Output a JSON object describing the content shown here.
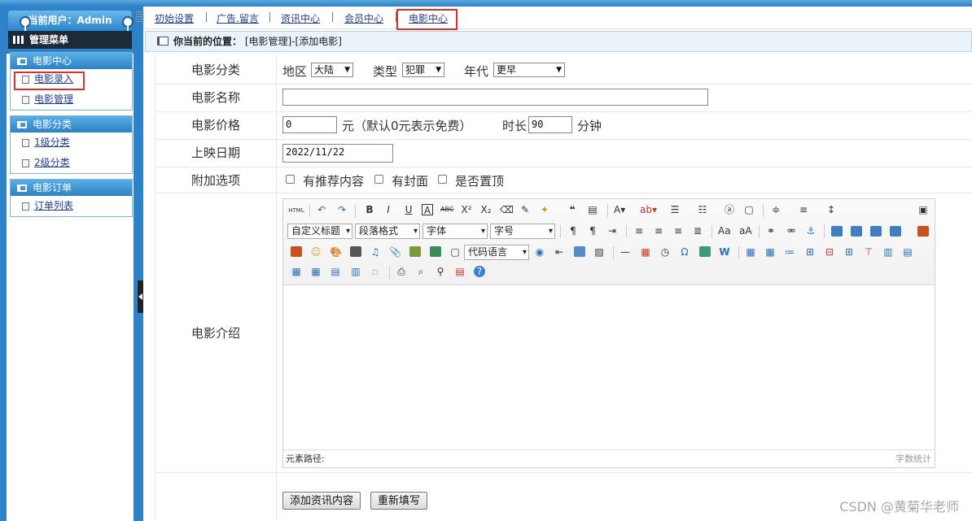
{
  "header": {
    "user_label": "当前用户：Admin"
  },
  "sidebar": {
    "menu_title": "管理菜单",
    "groups": [
      {
        "title": "电影中心",
        "items": [
          "电影录入",
          "电影管理"
        ]
      },
      {
        "title": "电影分类",
        "items": [
          "1级分类",
          "2级分类"
        ]
      },
      {
        "title": "电影订单",
        "items": [
          "订单列表"
        ]
      }
    ]
  },
  "nav": {
    "items": [
      "初始设置",
      "广告.留言",
      "资讯中心",
      "会员中心",
      "电影中心"
    ]
  },
  "breadcrumb": {
    "prefix": "你当前的位置：",
    "path": "[电影管理]-[添加电影]"
  },
  "form": {
    "category": {
      "label": "电影分类",
      "region_label": "地区",
      "region": "大陆",
      "type_label": "类型",
      "type": "犯罪",
      "era_label": "年代",
      "era": "更早"
    },
    "name": {
      "label": "电影名称",
      "value": ""
    },
    "price": {
      "label": "电影价格",
      "value": "0",
      "hint": "元（默认0元表示免费）",
      "duration_label": "时长",
      "duration": "90",
      "duration_unit": "分钟"
    },
    "release": {
      "label": "上映日期",
      "value": "2022/11/22"
    },
    "options": {
      "label": "附加选项",
      "items": [
        "有推荐内容",
        "有封面",
        "是否置顶"
      ]
    },
    "intro": {
      "label": "电影介绍"
    }
  },
  "editor": {
    "html_btn": "HTML",
    "selects": [
      "自定义标题",
      "段落格式",
      "字体",
      "字号",
      "代码语言"
    ],
    "status_path": "元素路径:",
    "word_count": "字数统计"
  },
  "buttons": {
    "submit": "添加资讯内容",
    "reset": "重新填写"
  },
  "watermark": "CSDN @黄菊华老师"
}
